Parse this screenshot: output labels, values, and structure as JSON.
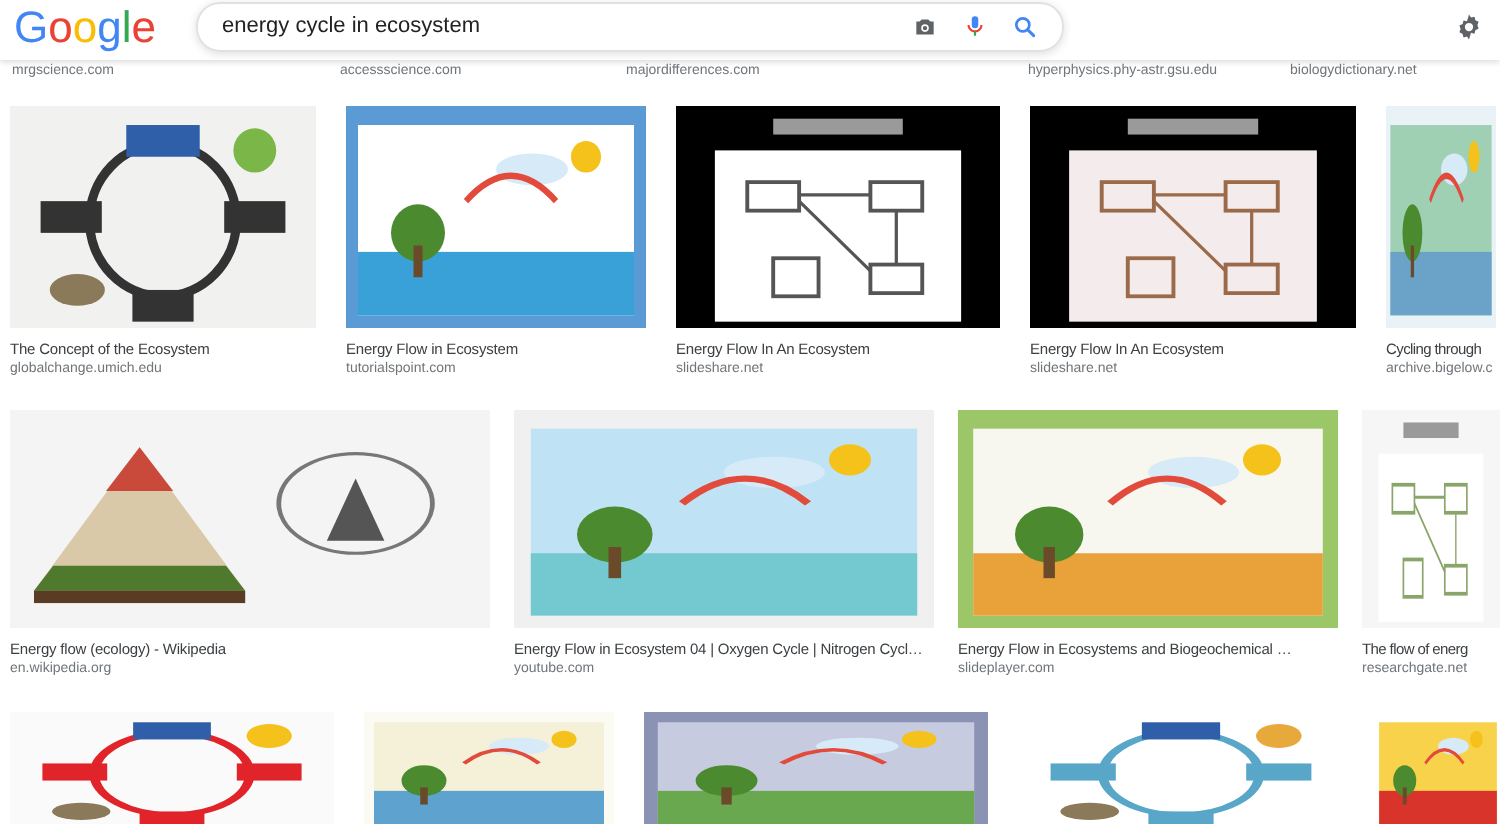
{
  "logo": "Google",
  "search": {
    "query": "energy cycle in ecosystem"
  },
  "previous_row_sources": [
    "mrgscience.com",
    "accessscience.com",
    "majordifferences.com",
    "hyperphysics.phy-astr.gsu.edu",
    "biologydictionary.net"
  ],
  "rows": [
    {
      "results": [
        {
          "title": "The Concept of the Ecosystem",
          "source": "globalchange.umich.edu"
        },
        {
          "title": "Energy Flow in Ecosystem",
          "source": "tutorialspoint.com"
        },
        {
          "title": "Energy Flow In An Ecosystem",
          "source": "slideshare.net"
        },
        {
          "title": "Energy Flow In An Ecosystem",
          "source": "slideshare.net"
        },
        {
          "title": "Cycling through",
          "source": "archive.bigelow.c"
        }
      ]
    },
    {
      "results": [
        {
          "title": "Energy flow (ecology) - Wikipedia",
          "source": "en.wikipedia.org"
        },
        {
          "title": "Energy Flow in Ecosystem 04 | Oxygen Cycle | Nitrogen Cycl…",
          "source": "youtube.com"
        },
        {
          "title": "Energy Flow in Ecosystems and Biogeochemical …",
          "source": "slideplayer.com"
        },
        {
          "title": "The flow of energ",
          "source": "researchgate.net"
        }
      ]
    }
  ]
}
